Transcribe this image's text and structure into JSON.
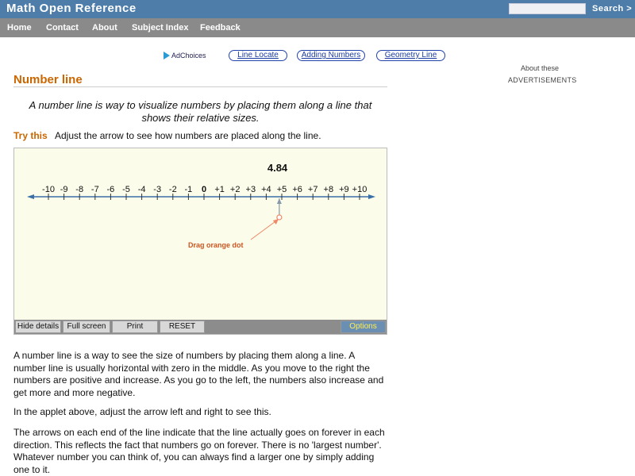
{
  "header": {
    "site_title": "Math Open Reference",
    "search_placeholder": "",
    "search_label": "Search >"
  },
  "nav": {
    "items": [
      "Home",
      "Contact",
      "About",
      "Subject Index",
      "Feedback"
    ]
  },
  "ads": {
    "adchoices_label": "AdChoices",
    "links": [
      "Line Locate",
      "Adding Numbers",
      "Geometry Line"
    ],
    "side_about": "About these",
    "side_label": "ADVERTISEMENTS"
  },
  "page": {
    "title": "Number line",
    "intro": "A number line is way to visualize numbers by placing them along a line that shows their relative sizes.",
    "try_label": "Try this",
    "try_text": "Adjust the arrow to see how numbers are placed along the line."
  },
  "applet": {
    "current_value": "4.84",
    "ticks": [
      "-10",
      "-9",
      "-8",
      "-7",
      "-6",
      "-5",
      "-4",
      "-3",
      "-2",
      "-1",
      "0",
      "+1",
      "+2",
      "+3",
      "+4",
      "+5",
      "+6",
      "+7",
      "+8",
      "+9",
      "+10"
    ],
    "drag_hint": "Drag  orange dot",
    "value": 4.84,
    "min": -10,
    "max": 10,
    "accent_color": "#ee8866",
    "line_color": "#3a6fa8",
    "buttons": [
      "Hide details",
      "Full screen",
      "Print",
      "RESET"
    ],
    "options_label": "Options"
  },
  "body": {
    "p1": "A number line is a way to see the size of numbers by placing them along a line. A number line is usually horizontal with zero in the middle. As you move to the right the numbers are positive and increase. As you go to the left, the numbers also increase and get more and more negative.",
    "p2": "In the applet above, adjust the arrow left and right to see this.",
    "p3": "The arrows on each end of the line indicate that the line actually goes on forever in each direction. This reflects the fact that numbers go on forever. There is no 'largest number'. Whatever number you can think of, you can always find a larger one by simply adding one to it."
  }
}
